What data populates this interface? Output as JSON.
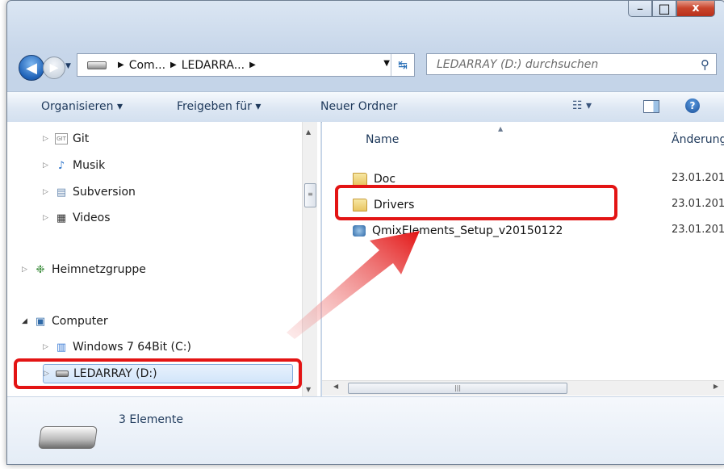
{
  "window": {
    "minimize": "–",
    "maximize": "□",
    "close": "x"
  },
  "address": {
    "crumb1": "Com...",
    "crumb2": "LEDARRA...",
    "search_placeholder": "LEDARRAY (D:) durchsuchen"
  },
  "toolbar": {
    "organize": "Organisieren ▾",
    "share": "Freigeben für ▾",
    "new_folder": "Neuer Ordner",
    "help": "?"
  },
  "tree": [
    {
      "label": "Git",
      "icon": "git-folder-icon"
    },
    {
      "label": "Musik",
      "icon": "music-icon"
    },
    {
      "label": "Subversion",
      "icon": "document-icon"
    },
    {
      "label": "Videos",
      "icon": "film-icon"
    },
    {
      "label": "Heimnetzgruppe",
      "icon": "homegroup-icon"
    },
    {
      "label": "Computer",
      "icon": "computer-icon"
    },
    {
      "label": "Windows 7 64Bit (C:)",
      "icon": "windows-drive-icon"
    },
    {
      "label": "LEDARRAY (D:)",
      "icon": "removable-drive-icon"
    }
  ],
  "columns": {
    "name": "Name",
    "date": "Änderung"
  },
  "files": [
    {
      "name": "Doc",
      "date": "23.01.201"
    },
    {
      "name": "Drivers",
      "date": "23.01.201"
    },
    {
      "name": "QmixElements_Setup_v20150122",
      "date": "23.01.201"
    }
  ],
  "status": {
    "count": "3 Elemente"
  },
  "colors": {
    "highlight": "#e31414",
    "accent": "#1e395b"
  }
}
